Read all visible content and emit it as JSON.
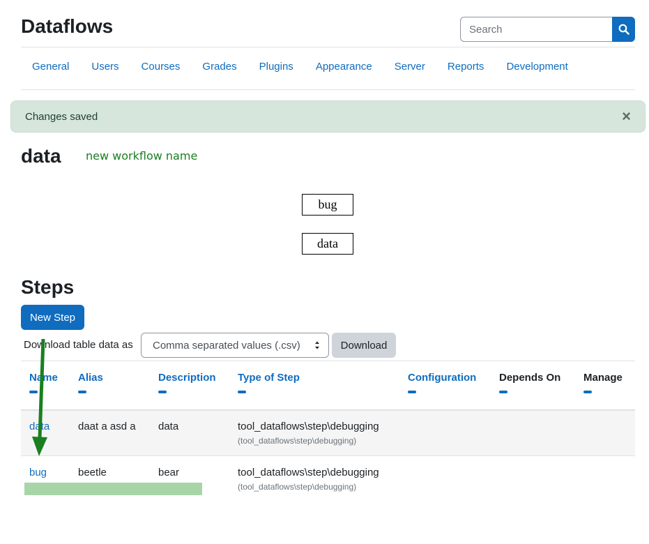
{
  "site": {
    "title": "Dataflows"
  },
  "search": {
    "placeholder": "Search",
    "icon": "search-icon"
  },
  "nav": {
    "items": [
      "General",
      "Users",
      "Courses",
      "Grades",
      "Plugins",
      "Appearance",
      "Server",
      "Reports",
      "Development"
    ]
  },
  "alert": {
    "message": "Changes saved",
    "close": "×"
  },
  "workflow": {
    "title": "data",
    "name_link": "new workflow name"
  },
  "diagram": {
    "nodes": [
      "bug",
      "data"
    ]
  },
  "steps": {
    "heading": "Steps",
    "new_button": "New Step",
    "download_label": "Download table data as",
    "format_selected": "Comma separated values (.csv)",
    "download_button": "Download"
  },
  "table": {
    "headers": [
      "Name",
      "Alias",
      "Description",
      "Type of Step",
      "Configuration",
      "Depends On",
      "Manage"
    ],
    "rows": [
      {
        "name": "data",
        "alias": "daat a asd a",
        "description": "data",
        "type": "tool_dataflows\\step\\debugging",
        "type_sub": "(tool_dataflows\\step\\debugging)"
      },
      {
        "name": "bug",
        "alias": "beetle",
        "description": "bear",
        "type": "tool_dataflows\\step\\debugging",
        "type_sub": "(tool_dataflows\\step\\debugging)"
      }
    ]
  },
  "colors": {
    "primary": "#0f6cbf",
    "alert_bg": "#d7e6dd",
    "annotation_green": "#1a7f21",
    "highlight": "#a8d5a8"
  }
}
